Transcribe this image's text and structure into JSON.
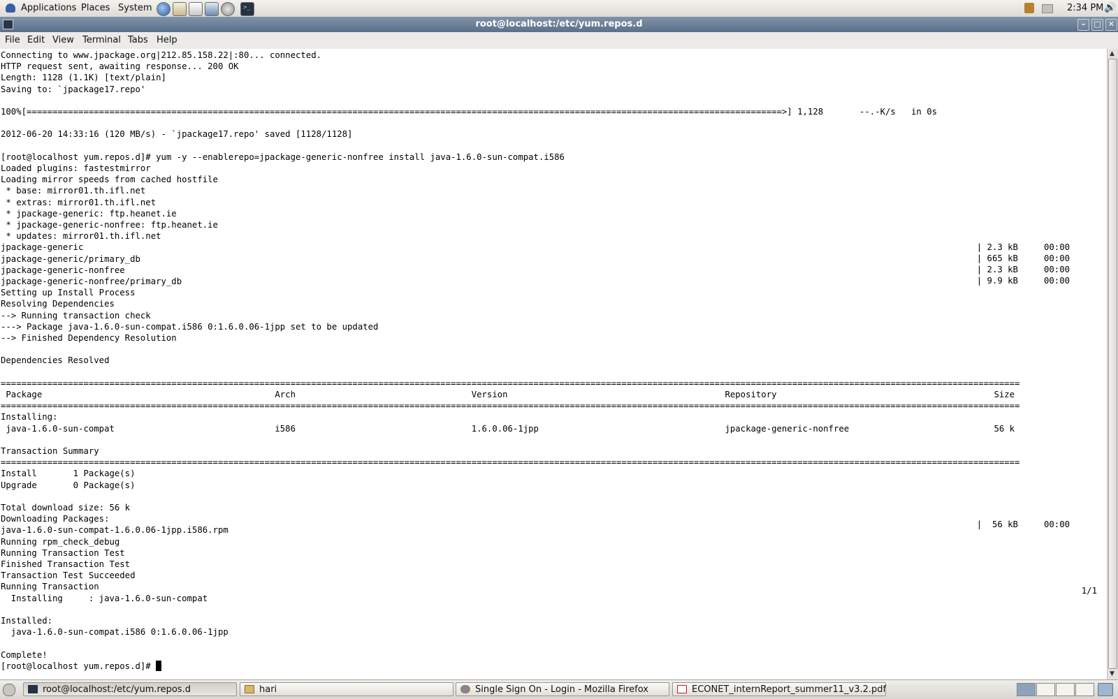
{
  "top_panel": {
    "menus": [
      "Applications",
      "Places",
      "System"
    ],
    "launchers": [
      "browser-icon",
      "email-icon",
      "text-editor-icon",
      "image-viewer-icon",
      "settings-icon",
      "terminal-icon"
    ],
    "clock": "2:34 PM"
  },
  "window": {
    "title": "root@localhost:/etc/yum.repos.d",
    "menu": [
      "File",
      "Edit",
      "View",
      "Terminal",
      "Tabs",
      "Help"
    ]
  },
  "terminal": {
    "left_lines": [
      "Connecting to www.jpackage.org|212.85.158.22|:80... connected.",
      "HTTP request sent, awaiting response... 200 OK",
      "Length: 1128 (1.1K) [text/plain]",
      "Saving to: `jpackage17.repo'",
      "",
      "100%[==================================================================================================================================================>] 1,128       --.-K/s   in 0s",
      "",
      "2012-06-20 14:33:16 (120 MB/s) - `jpackage17.repo' saved [1128/1128]",
      "",
      "[root@localhost yum.repos.d]# yum -y --enablerepo=jpackage-generic-nonfree install java-1.6.0-sun-compat.i586",
      "Loaded plugins: fastestmirror",
      "Loading mirror speeds from cached hostfile",
      " * base: mirror01.th.ifl.net",
      " * extras: mirror01.th.ifl.net",
      " * jpackage-generic: ftp.heanet.ie",
      " * jpackage-generic-nonfree: ftp.heanet.ie",
      " * updates: mirror01.th.ifl.net",
      "jpackage-generic",
      "jpackage-generic/primary_db",
      "jpackage-generic-nonfree",
      "jpackage-generic-nonfree/primary_db",
      "Setting up Install Process",
      "Resolving Dependencies",
      "--> Running transaction check",
      "---> Package java-1.6.0-sun-compat.i586 0:1.6.0.06-1jpp set to be updated",
      "--> Finished Dependency Resolution",
      "",
      "Dependencies Resolved",
      "",
      "=====================================================================================================================================================================================================",
      " Package                                             Arch                                  Version                                          Repository                                          Size",
      "=====================================================================================================================================================================================================",
      "Installing:",
      " java-1.6.0-sun-compat                               i586                                  1.6.0.06-1jpp                                    jpackage-generic-nonfree                            56 k",
      "",
      "Transaction Summary",
      "=====================================================================================================================================================================================================",
      "Install       1 Package(s)",
      "Upgrade       0 Package(s)",
      "",
      "Total download size: 56 k",
      "Downloading Packages:",
      "java-1.6.0-sun-compat-1.6.0.06-1jpp.i586.rpm",
      "Running rpm_check_debug",
      "Running Transaction Test",
      "Finished Transaction Test",
      "Transaction Test Succeeded",
      "Running Transaction",
      "  Installing     : java-1.6.0-sun-compat",
      "",
      "Installed:",
      "  java-1.6.0-sun-compat.i586 0:1.6.0.06-1jpp",
      "",
      "Complete!",
      "[root@localhost yum.repos.d]# "
    ],
    "right_texts": [
      "| 2.3 kB     00:00",
      "| 665 kB     00:00",
      "| 2.3 kB     00:00",
      "| 9.9 kB     00:00",
      "|  56 kB     00:00",
      "1/1"
    ]
  },
  "taskbar": {
    "tasks": [
      "root@localhost:/etc/yum.repos.d",
      "hari",
      "Single Sign On - Login - Mozilla Firefox",
      "ECONET_internReport_summer11_v3.2.pdf"
    ],
    "workspaces": [
      "1",
      "2",
      "3",
      "4"
    ]
  }
}
